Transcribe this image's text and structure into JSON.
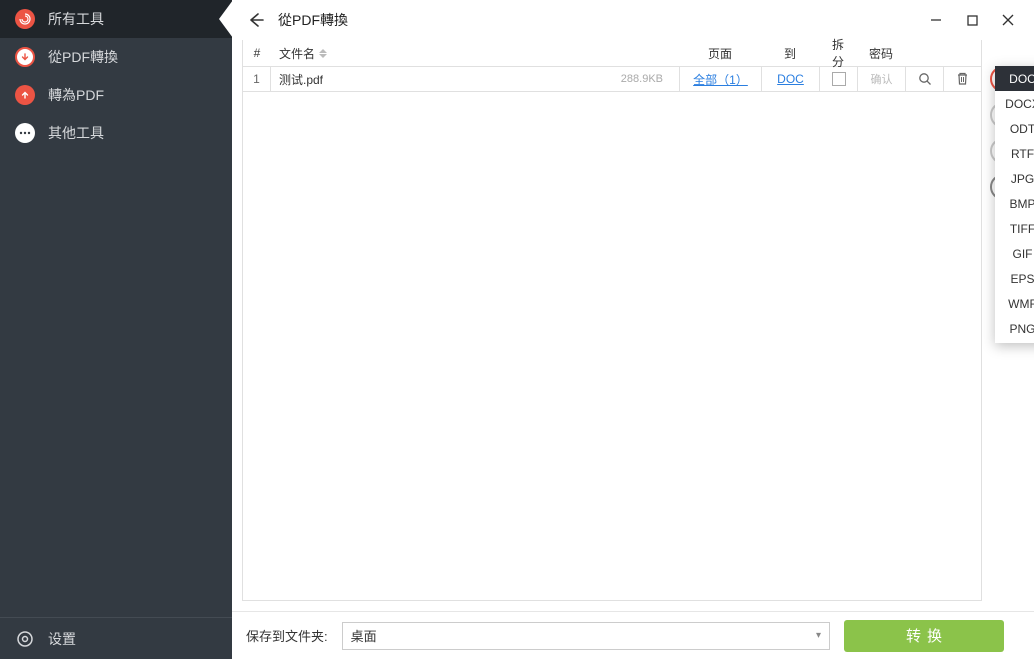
{
  "sidebar": {
    "items": [
      {
        "label": "所有工具"
      },
      {
        "label": "從PDF轉換"
      },
      {
        "label": "轉為PDF"
      },
      {
        "label": "其他工具"
      }
    ],
    "settings_label": "设置"
  },
  "titlebar": {
    "title": "從PDF轉換"
  },
  "table": {
    "headers": {
      "index": "#",
      "filename": "文件名",
      "page": "页面",
      "to": "到",
      "split": "拆分",
      "password": "密码"
    },
    "rows": [
      {
        "index": "1",
        "filename": "测试.pdf",
        "size": "288.9KB",
        "page": "全部（1）",
        "to": "DOC",
        "password_hint": "确认"
      }
    ]
  },
  "dropdown": {
    "options": [
      "DOC",
      "DOCX",
      "ODT",
      "RTF",
      "JPG",
      "BMP",
      "TIFF",
      "GIF",
      "EPS",
      "WMF",
      "PNG"
    ],
    "selected": "DOC"
  },
  "footer": {
    "save_label": "保存到文件夹:",
    "save_target": "桌面",
    "convert_label": "转换"
  }
}
